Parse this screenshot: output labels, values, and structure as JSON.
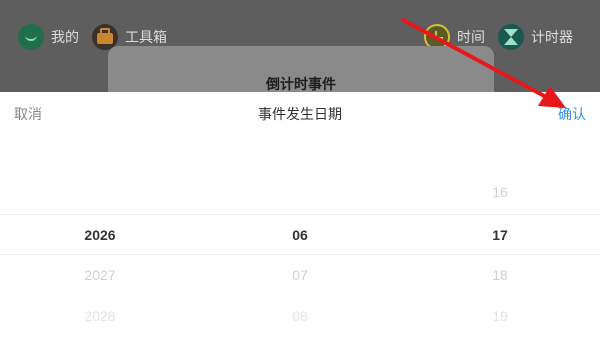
{
  "background_nav": {
    "items": [
      {
        "label": "我的",
        "icon": "smile-icon"
      },
      {
        "label": "工具箱",
        "icon": "toolbox-icon"
      },
      {
        "label": "时间",
        "icon": "clock-icon"
      },
      {
        "label": "计时器",
        "icon": "hourglass-icon"
      }
    ]
  },
  "background_dialog": {
    "title": "倒计时事件"
  },
  "sheet": {
    "cancel_label": "取消",
    "title": "事件发生日期",
    "confirm_label": "确认"
  },
  "picker": {
    "year": {
      "selected": "2026",
      "below": [
        "2027",
        "2028"
      ]
    },
    "month": {
      "selected": "06",
      "below": [
        "07",
        "08"
      ]
    },
    "day": {
      "above": [
        "16"
      ],
      "selected": "17",
      "below": [
        "18",
        "19"
      ]
    }
  },
  "colors": {
    "accent": "#3d8fe0",
    "annotation_arrow": "#e8171b"
  }
}
